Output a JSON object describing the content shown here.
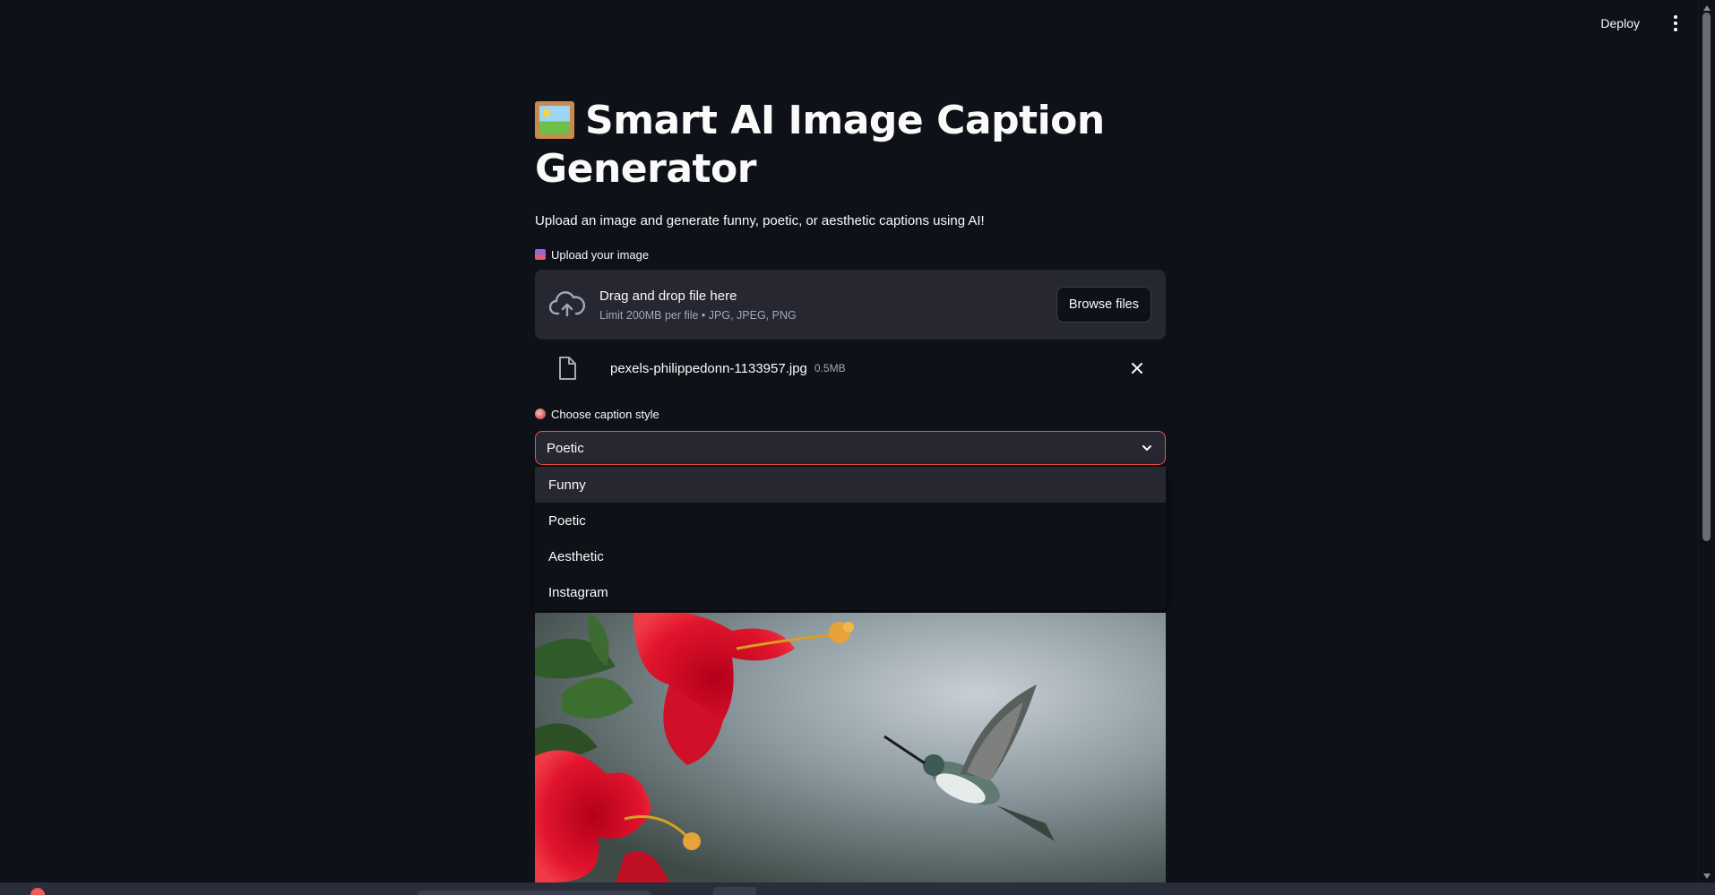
{
  "header": {
    "deploy_label": "Deploy",
    "menu_icon": "kebab-menu-icon"
  },
  "main": {
    "title": "Smart AI Image Caption Generator",
    "title_icon": "framed-picture-emoji",
    "subtitle": "Upload an image and generate funny, poetic, or aesthetic captions using AI!"
  },
  "uploader": {
    "label": "Upload your image",
    "label_icon": "inbox-tray-emoji",
    "drop_title": "Drag and drop file here",
    "limit_text": "Limit 200MB per file • JPG, JPEG, PNG",
    "browse_label": "Browse files",
    "upload_icon": "cloud-upload-icon"
  },
  "uploaded_file": {
    "name": "pexels-philippedonn-1133957.jpg",
    "size": "0.5MB",
    "file_icon": "file-icon",
    "remove_icon": "close-icon"
  },
  "caption_style": {
    "label": "Choose caption style",
    "label_icon": "artist-palette-emoji",
    "selected": "Poetic",
    "options": [
      "Funny",
      "Poetic",
      "Aesthetic",
      "Instagram"
    ],
    "highlighted_option": "Funny"
  },
  "image": {
    "subject": "hummingbird-and-red-hibiscus-photo"
  },
  "colors": {
    "background": "#0e1117",
    "surface": "#262730",
    "accent": "#ff4b4b",
    "text": "#fafafa",
    "muted_text": "#a3a8b8"
  }
}
